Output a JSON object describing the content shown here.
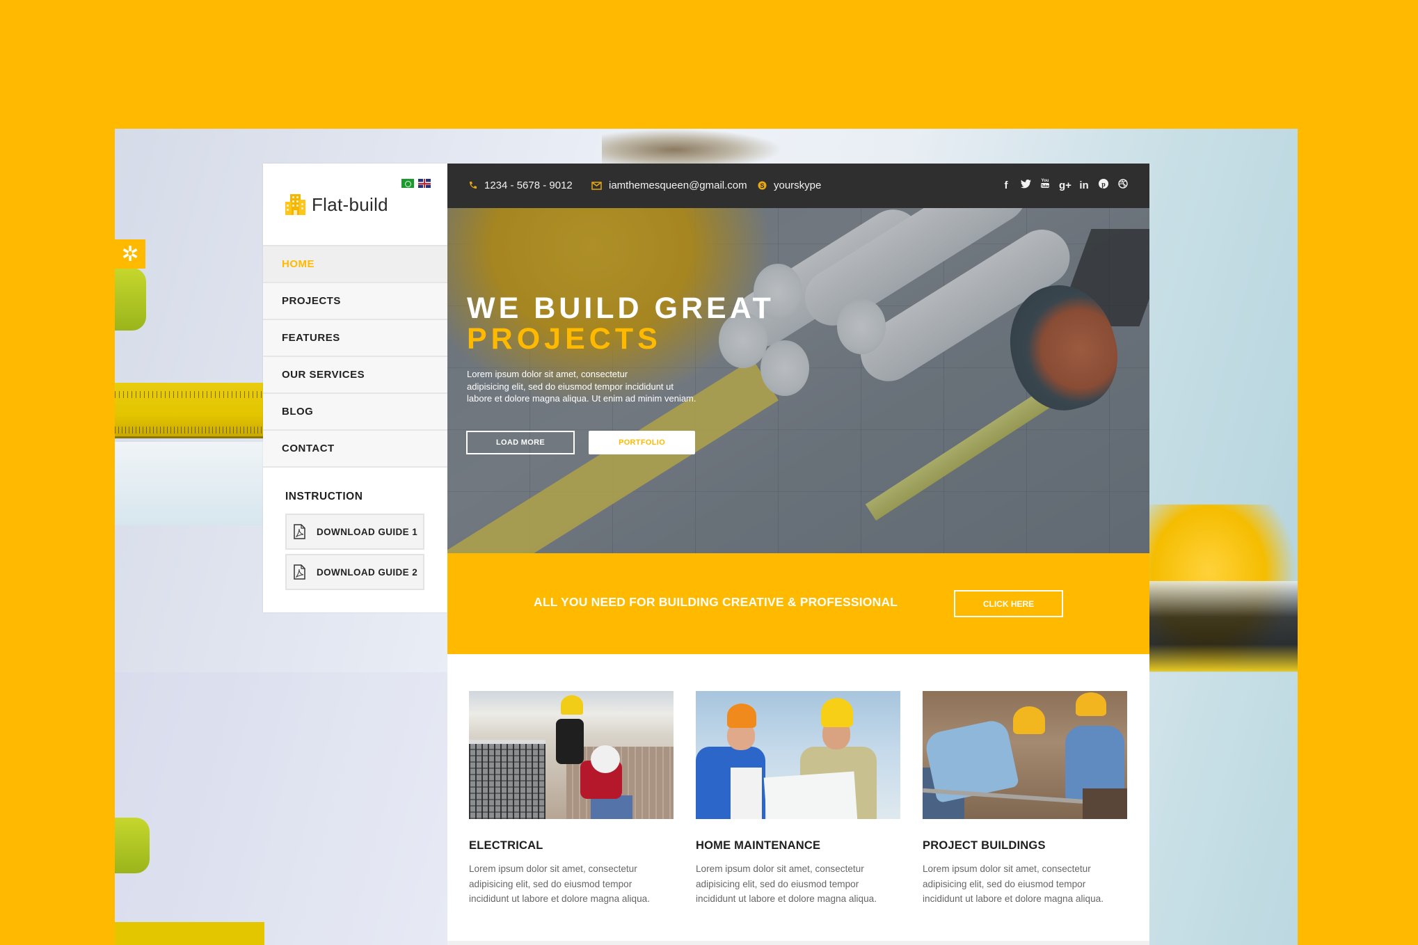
{
  "site": {
    "brand": "Flat-build",
    "accent_color": "#FFBA00",
    "dark_color": "#2F2F2F"
  },
  "settings_tab": {
    "icon": "gear-icon"
  },
  "languages": [
    {
      "code": "ar",
      "icon": "arabic-flag-icon"
    },
    {
      "code": "en",
      "icon": "uk-flag-icon"
    }
  ],
  "sidebar": {
    "nav": [
      {
        "label": "HOME",
        "active": true
      },
      {
        "label": "PROJECTS",
        "active": false
      },
      {
        "label": "FEATURES",
        "active": false
      },
      {
        "label": "OUR SERVICES",
        "active": false
      },
      {
        "label": "BLOG",
        "active": false
      },
      {
        "label": "CONTACT",
        "active": false
      }
    ],
    "instruction": {
      "title": "INSTRUCTION",
      "downloads": [
        {
          "label": "DOWNLOAD GUIDE 1",
          "icon": "pdf-file-icon"
        },
        {
          "label": "DOWNLOAD GUIDE 2",
          "icon": "pdf-file-icon"
        }
      ]
    }
  },
  "topbar": {
    "phone": "1234 - 5678 - 9012",
    "email": "iamthemesqueen@gmail.com",
    "skype": "yourskype",
    "socials": [
      {
        "name": "facebook",
        "glyph": "f"
      },
      {
        "name": "twitter",
        "glyph": "t"
      },
      {
        "name": "youtube",
        "glyph": "▶"
      },
      {
        "name": "google-plus",
        "glyph": "g+"
      },
      {
        "name": "linkedin",
        "glyph": "in"
      },
      {
        "name": "pinterest",
        "glyph": "P"
      },
      {
        "name": "dribbble",
        "glyph": "◎"
      }
    ]
  },
  "hero": {
    "title_line1": "WE BUILD GREAT",
    "title_line2": "PROJECTS",
    "text": "Lorem ipsum dolor sit amet, consectetur adipisicing elit, sed do eiusmod tempor incididunt ut labore et dolore magna aliqua. Ut enim ad minim veniam.",
    "text_lines": [
      "Lorem ipsum dolor sit amet, consectetur",
      "adipisicing elit, sed do eiusmod tempor incididunt ut",
      "labore et dolore magna aliqua. Ut enim ad minim veniam."
    ],
    "btn_load_more": "LOAD MORE",
    "btn_portfolio": "PORTFOLIO"
  },
  "cta": {
    "text": "ALL YOU NEED FOR BUILDING CREATIVE & PROFESSIONAL",
    "button": "CLICK HERE"
  },
  "services": [
    {
      "title": "ELECTRICAL",
      "text_lines": [
        "Lorem ipsum dolor sit amet, consectetur",
        "adipisicing elit, sed do eiusmod tempor",
        "incididunt ut labore et dolore magna aliqua."
      ]
    },
    {
      "title": "HOME MAINTENANCE",
      "text_lines": [
        "Lorem ipsum dolor sit amet, consectetur",
        "adipisicing elit, sed do eiusmod tempor",
        "incididunt ut labore et dolore magna aliqua."
      ]
    },
    {
      "title": "PROJECT BUILDINGS",
      "text_lines": [
        "Lorem ipsum dolor sit amet, consectetur",
        "adipisicing elit, sed do eiusmod tempor",
        "incididunt ut labore et dolore magna aliqua."
      ]
    }
  ]
}
